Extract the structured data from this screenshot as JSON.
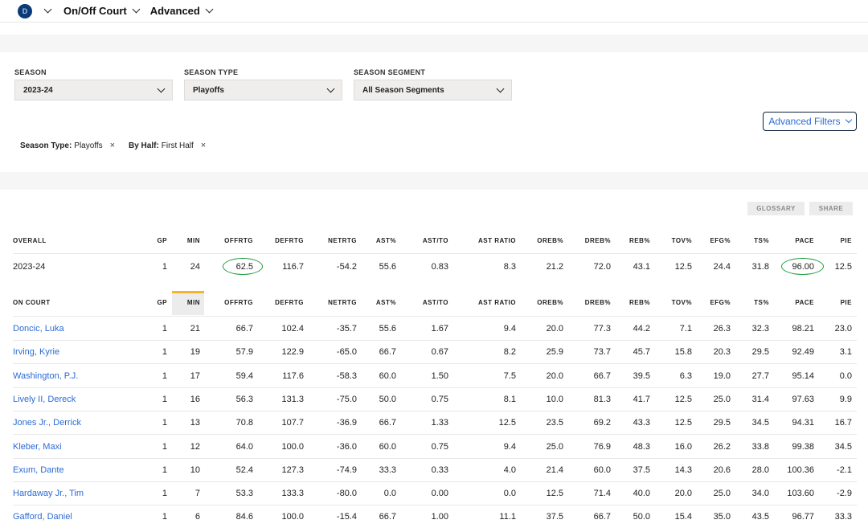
{
  "nav": {
    "logo_text": "D",
    "selector1": "On/Off Court",
    "selector2": "Advanced"
  },
  "filters": {
    "season": {
      "label": "SEASON",
      "value": "2023-24"
    },
    "season_type": {
      "label": "SEASON TYPE",
      "value": "Playoffs"
    },
    "season_segment": {
      "label": "SEASON SEGMENT",
      "value": "All Season Segments"
    },
    "advanced_button": "Advanced Filters",
    "chips": [
      {
        "key": "Season Type:",
        "value": "Playoffs",
        "close": "×"
      },
      {
        "key": "By Half:",
        "value": "First Half",
        "close": "×"
      }
    ]
  },
  "actions": {
    "glossary": "GLOSSARY",
    "share": "SHARE"
  },
  "overall": {
    "header": [
      "OVERALL",
      "GP",
      "MIN",
      "OFFRTG",
      "DEFRTG",
      "NETRTG",
      "AST%",
      "AST/TO",
      "AST RATIO",
      "OREB%",
      "DREB%",
      "REB%",
      "TOV%",
      "EFG%",
      "TS%",
      "PACE",
      "PIE"
    ],
    "row": [
      "2023-24",
      "1",
      "24",
      "62.5",
      "116.7",
      "-54.2",
      "55.6",
      "0.83",
      "8.3",
      "21.2",
      "72.0",
      "43.1",
      "12.5",
      "24.4",
      "31.8",
      "96.00",
      "12.5"
    ]
  },
  "on_court": {
    "header": [
      "ON COURT",
      "GP",
      "MIN",
      "OFFRTG",
      "DEFRTG",
      "NETRTG",
      "AST%",
      "AST/TO",
      "AST RATIO",
      "OREB%",
      "DREB%",
      "REB%",
      "TOV%",
      "EFG%",
      "TS%",
      "PACE",
      "PIE"
    ],
    "rows": [
      [
        "Doncic, Luka",
        "1",
        "21",
        "66.7",
        "102.4",
        "-35.7",
        "55.6",
        "1.67",
        "9.4",
        "20.0",
        "77.3",
        "44.2",
        "7.1",
        "26.3",
        "32.3",
        "98.21",
        "23.0"
      ],
      [
        "Irving, Kyrie",
        "1",
        "19",
        "57.9",
        "122.9",
        "-65.0",
        "66.7",
        "0.67",
        "8.2",
        "25.9",
        "73.7",
        "45.7",
        "15.8",
        "20.3",
        "29.5",
        "92.49",
        "3.1"
      ],
      [
        "Washington, P.J.",
        "1",
        "17",
        "59.4",
        "117.6",
        "-58.3",
        "60.0",
        "1.50",
        "7.5",
        "20.0",
        "66.7",
        "39.5",
        "6.3",
        "19.0",
        "27.7",
        "95.14",
        "0.0"
      ],
      [
        "Lively II, Dereck",
        "1",
        "16",
        "56.3",
        "131.3",
        "-75.0",
        "50.0",
        "0.75",
        "8.1",
        "10.0",
        "81.3",
        "41.7",
        "12.5",
        "25.0",
        "31.4",
        "97.63",
        "9.9"
      ],
      [
        "Jones Jr., Derrick",
        "1",
        "13",
        "70.8",
        "107.7",
        "-36.9",
        "66.7",
        "1.33",
        "12.5",
        "23.5",
        "69.2",
        "43.3",
        "12.5",
        "29.5",
        "34.5",
        "94.31",
        "16.7"
      ],
      [
        "Kleber, Maxi",
        "1",
        "12",
        "64.0",
        "100.0",
        "-36.0",
        "60.0",
        "0.75",
        "9.4",
        "25.0",
        "76.9",
        "48.3",
        "16.0",
        "26.2",
        "33.8",
        "99.38",
        "34.5"
      ],
      [
        "Exum, Dante",
        "1",
        "10",
        "52.4",
        "127.3",
        "-74.9",
        "33.3",
        "0.33",
        "4.0",
        "21.4",
        "60.0",
        "37.5",
        "14.3",
        "20.6",
        "28.0",
        "100.36",
        "-2.1"
      ],
      [
        "Hardaway Jr., Tim",
        "1",
        "7",
        "53.3",
        "133.3",
        "-80.0",
        "0.0",
        "0.00",
        "0.0",
        "12.5",
        "71.4",
        "40.0",
        "20.0",
        "25.0",
        "34.0",
        "103.60",
        "-2.9"
      ],
      [
        "Gafford, Daniel",
        "1",
        "6",
        "84.6",
        "100.0",
        "-15.4",
        "66.7",
        "1.00",
        "11.1",
        "37.5",
        "66.7",
        "50.0",
        "15.4",
        "35.0",
        "43.5",
        "96.77",
        "33.3"
      ]
    ]
  },
  "colors": {
    "link": "#2b6bd6",
    "highlight_circle": "#1e9a3a",
    "sort_indicator": "#f4b52a"
  }
}
